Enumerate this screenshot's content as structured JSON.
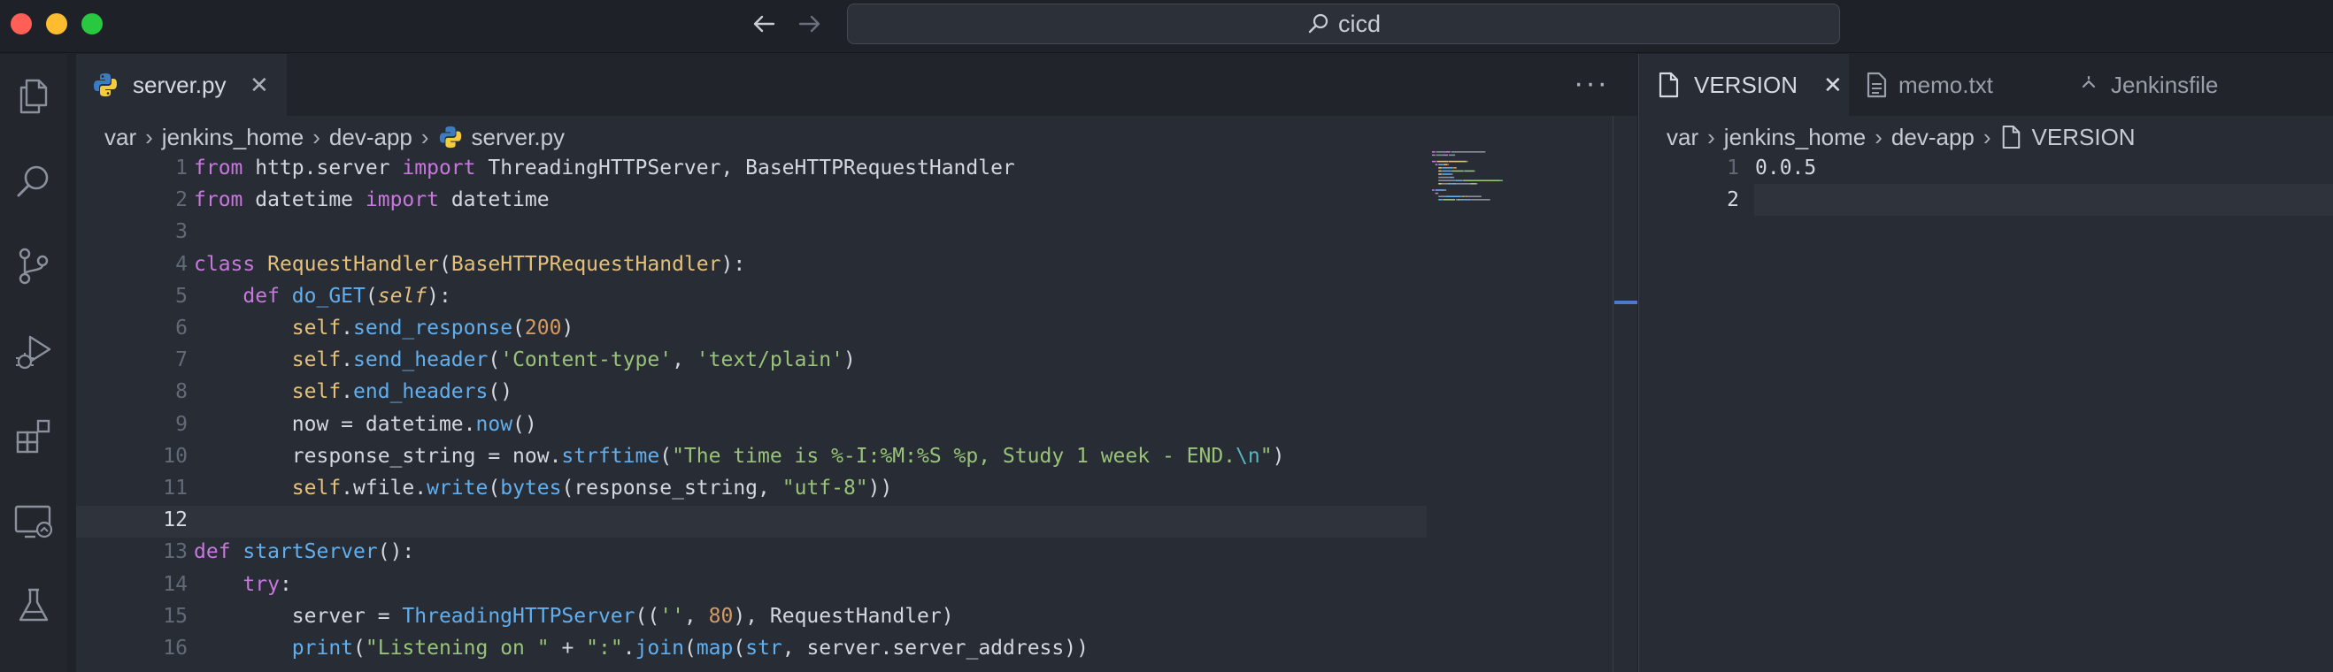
{
  "window": {
    "command_center": "cicd"
  },
  "activity_bar": {
    "icons": [
      "explorer-icon",
      "search-icon",
      "source-control-icon",
      "run-debug-icon",
      "extensions-icon",
      "remote-explorer-icon",
      "testing-icon"
    ]
  },
  "editor_left": {
    "tab": {
      "label": "server.py",
      "close": "✕"
    },
    "more_actions": "···",
    "breadcrumb": [
      "var",
      "jenkins_home",
      "dev-app",
      "server.py"
    ],
    "current_line": 12,
    "lines": [
      {
        "n": "1",
        "tokens": [
          [
            "kw",
            "from"
          ],
          [
            "plain",
            " http.server "
          ],
          [
            "kw",
            "import"
          ],
          [
            "plain",
            " ThreadingHTTPServer, BaseHTTPRequestHandler"
          ]
        ]
      },
      {
        "n": "2",
        "tokens": [
          [
            "kw",
            "from"
          ],
          [
            "plain",
            " datetime "
          ],
          [
            "kw",
            "import"
          ],
          [
            "plain",
            " datetime"
          ]
        ]
      },
      {
        "n": "3",
        "tokens": []
      },
      {
        "n": "4",
        "tokens": [
          [
            "kw",
            "class"
          ],
          [
            "plain",
            " "
          ],
          [
            "cls",
            "RequestHandler"
          ],
          [
            "plain",
            "("
          ],
          [
            "cls",
            "BaseHTTPRequestHandler"
          ],
          [
            "plain",
            "):"
          ]
        ]
      },
      {
        "n": "5",
        "tokens": [
          [
            "plain",
            "    "
          ],
          [
            "kw",
            "def"
          ],
          [
            "plain",
            " "
          ],
          [
            "fn",
            "do_GET"
          ],
          [
            "plain",
            "("
          ],
          [
            "param",
            "self"
          ],
          [
            "plain",
            "):"
          ]
        ]
      },
      {
        "n": "6",
        "tokens": [
          [
            "plain",
            "        "
          ],
          [
            "self",
            "self"
          ],
          [
            "plain",
            "."
          ],
          [
            "fn",
            "send_response"
          ],
          [
            "plain",
            "("
          ],
          [
            "num",
            "200"
          ],
          [
            "plain",
            ")"
          ]
        ]
      },
      {
        "n": "7",
        "tokens": [
          [
            "plain",
            "        "
          ],
          [
            "self",
            "self"
          ],
          [
            "plain",
            "."
          ],
          [
            "fn",
            "send_header"
          ],
          [
            "plain",
            "("
          ],
          [
            "str",
            "'Content-type'"
          ],
          [
            "plain",
            ", "
          ],
          [
            "str",
            "'text/plain'"
          ],
          [
            "plain",
            ")"
          ]
        ]
      },
      {
        "n": "8",
        "tokens": [
          [
            "plain",
            "        "
          ],
          [
            "self",
            "self"
          ],
          [
            "plain",
            "."
          ],
          [
            "fn",
            "end_headers"
          ],
          [
            "plain",
            "()"
          ]
        ]
      },
      {
        "n": "9",
        "tokens": [
          [
            "plain",
            "        now = datetime."
          ],
          [
            "fn",
            "now"
          ],
          [
            "plain",
            "()"
          ]
        ]
      },
      {
        "n": "10",
        "tokens": [
          [
            "plain",
            "        response_string = now."
          ],
          [
            "fn",
            "strftime"
          ],
          [
            "plain",
            "("
          ],
          [
            "str",
            "\"The time is %-I:%M:%S %p, Study 1 week - END."
          ],
          [
            "esc",
            "\\n"
          ],
          [
            "str",
            "\""
          ],
          [
            "plain",
            ")"
          ]
        ]
      },
      {
        "n": "11",
        "tokens": [
          [
            "plain",
            "        "
          ],
          [
            "self",
            "self"
          ],
          [
            "plain",
            ".wfile."
          ],
          [
            "fn",
            "write"
          ],
          [
            "plain",
            "("
          ],
          [
            "fn",
            "bytes"
          ],
          [
            "plain",
            "(response_string, "
          ],
          [
            "str",
            "\"utf-8\""
          ],
          [
            "plain",
            "))"
          ]
        ]
      },
      {
        "n": "12",
        "tokens": []
      },
      {
        "n": "13",
        "tokens": [
          [
            "kw",
            "def"
          ],
          [
            "plain",
            " "
          ],
          [
            "fn",
            "startServer"
          ],
          [
            "plain",
            "():"
          ]
        ]
      },
      {
        "n": "14",
        "tokens": [
          [
            "plain",
            "    "
          ],
          [
            "kw",
            "try"
          ],
          [
            "plain",
            ":"
          ]
        ]
      },
      {
        "n": "15",
        "tokens": [
          [
            "plain",
            "        server = "
          ],
          [
            "fn",
            "ThreadingHTTPServer"
          ],
          [
            "plain",
            "(("
          ],
          [
            "str",
            "''"
          ],
          [
            "plain",
            ", "
          ],
          [
            "num",
            "80"
          ],
          [
            "plain",
            "), RequestHandler)"
          ]
        ]
      },
      {
        "n": "16",
        "tokens": [
          [
            "plain",
            "        "
          ],
          [
            "fn",
            "print"
          ],
          [
            "plain",
            "("
          ],
          [
            "str",
            "\"Listening on \""
          ],
          [
            "plain",
            " + "
          ],
          [
            "str",
            "\":\""
          ],
          [
            "plain",
            "."
          ],
          [
            "fn",
            "join"
          ],
          [
            "plain",
            "("
          ],
          [
            "fn",
            "map"
          ],
          [
            "plain",
            "("
          ],
          [
            "fn",
            "str"
          ],
          [
            "plain",
            ", server.server_address))"
          ]
        ]
      }
    ]
  },
  "editor_right": {
    "tabs": [
      {
        "label": "VERSION",
        "close": "✕",
        "icon": "file-icon",
        "active": true
      },
      {
        "label": "memo.txt",
        "icon": "text-file-icon",
        "active": false
      },
      {
        "label": "Jenkinsfile",
        "icon": "jenkins-icon",
        "active": false
      }
    ],
    "breadcrumb": [
      "var",
      "jenkins_home",
      "dev-app",
      "VERSION"
    ],
    "current_line": 2,
    "lines": [
      {
        "n": "1",
        "text": "0.0.5"
      },
      {
        "n": "2",
        "text": ""
      }
    ]
  },
  "colors": {
    "keyword": "#c678dd",
    "class": "#e5c07b",
    "function": "#61afef",
    "string": "#98c379",
    "number": "#d19a66",
    "escape": "#56b6c2"
  }
}
